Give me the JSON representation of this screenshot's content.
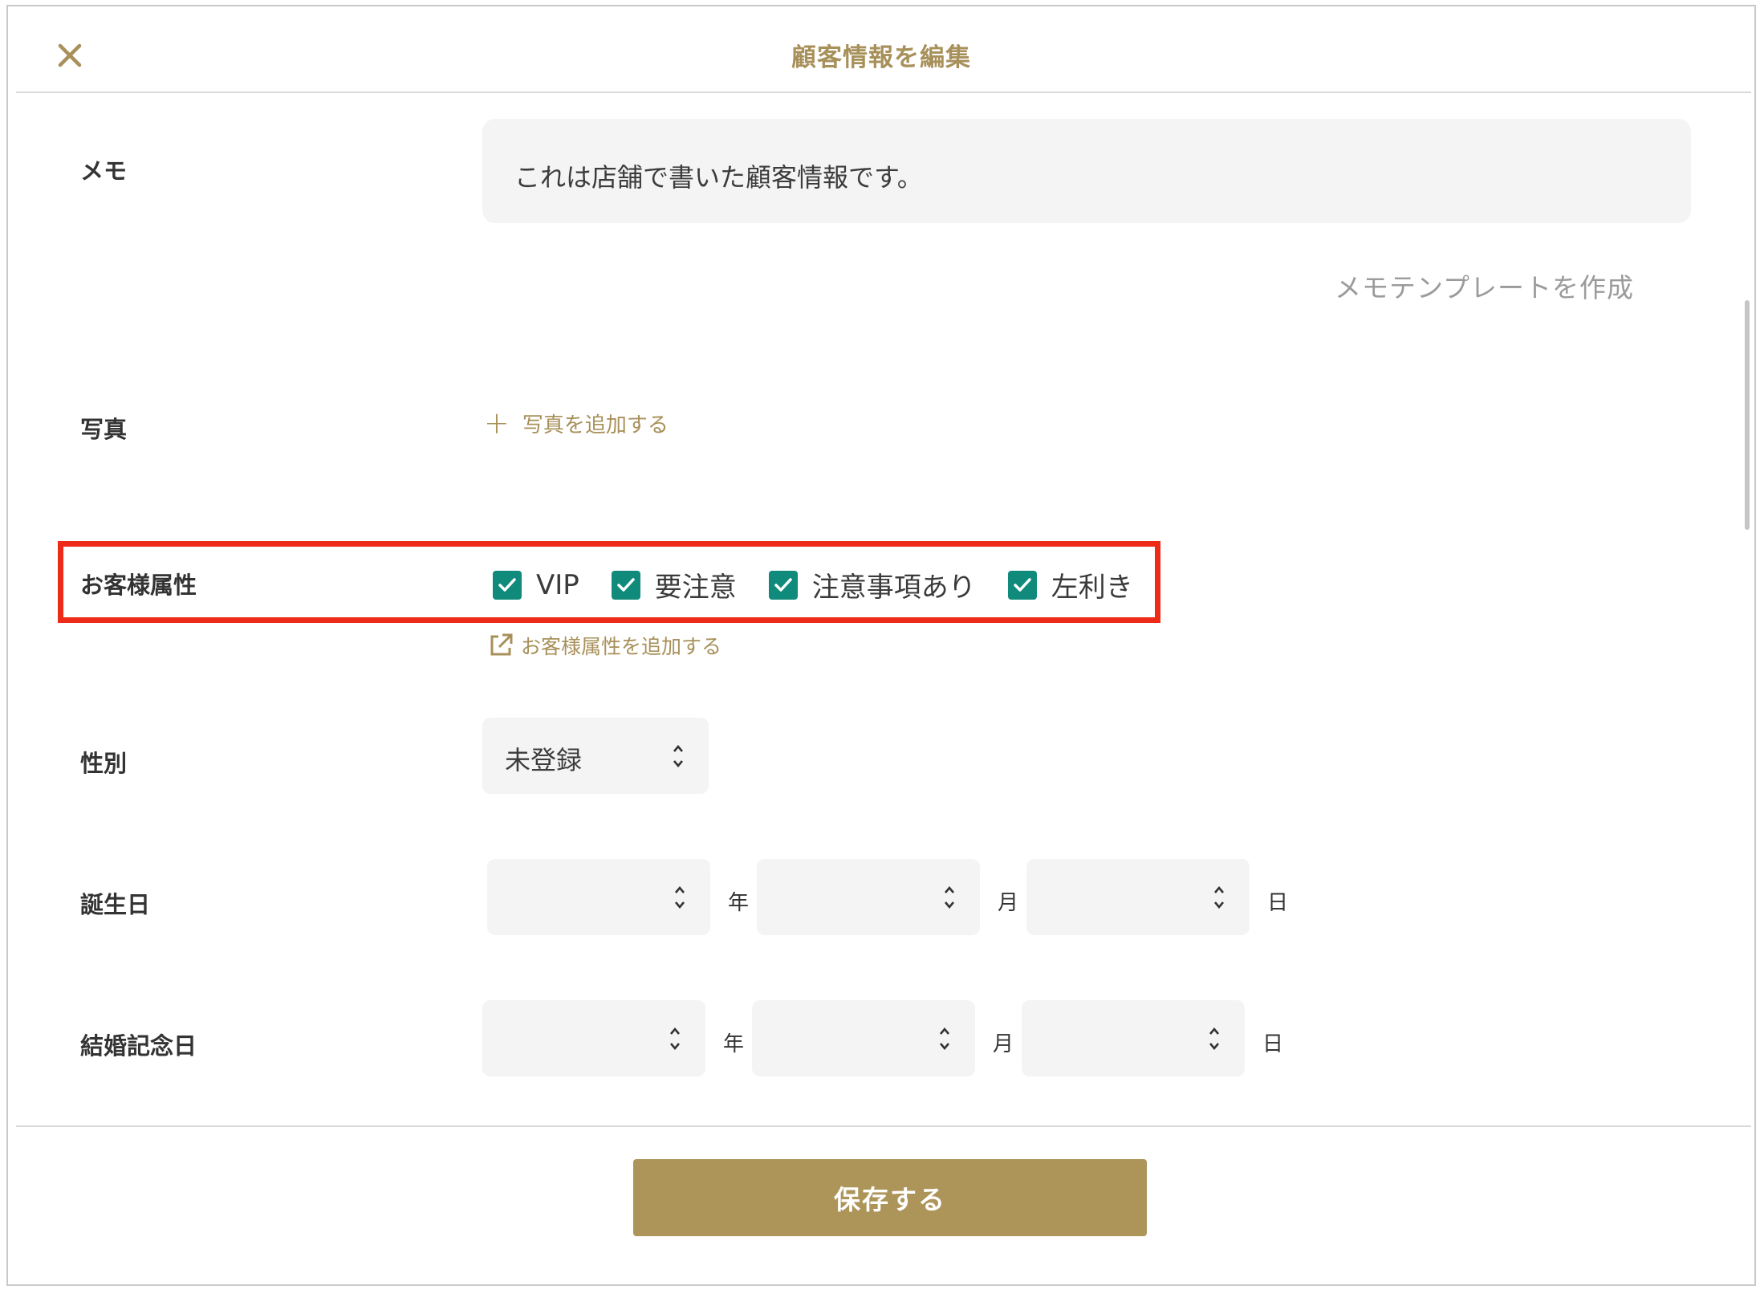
{
  "header": {
    "title": "顧客情報を編集",
    "close_icon": "close-icon"
  },
  "memo": {
    "label": "メモ",
    "value": "これは店舗で書いた顧客情報です。",
    "template_link": "メモテンプレートを作成"
  },
  "photo": {
    "label": "写真",
    "add_link": "写真を追加する"
  },
  "attributes": {
    "label": "お客様属性",
    "items": [
      {
        "label": "VIP",
        "checked": true
      },
      {
        "label": "要注意",
        "checked": true
      },
      {
        "label": "注意事項あり",
        "checked": true
      },
      {
        "label": "左利き",
        "checked": true
      }
    ],
    "add_link": "お客様属性を追加する"
  },
  "gender": {
    "label": "性別",
    "value": "未登録"
  },
  "birthday": {
    "label": "誕生日",
    "year_unit": "年",
    "month_unit": "月",
    "day_unit": "日"
  },
  "anniversary": {
    "label": "結婚記念日",
    "year_unit": "年",
    "month_unit": "月",
    "day_unit": "日"
  },
  "footer": {
    "save_label": "保存する"
  },
  "colors": {
    "accent": "#a8905a",
    "button": "#ad9459",
    "checkbox": "#0f8a7b",
    "highlight": "#ee2a18"
  }
}
